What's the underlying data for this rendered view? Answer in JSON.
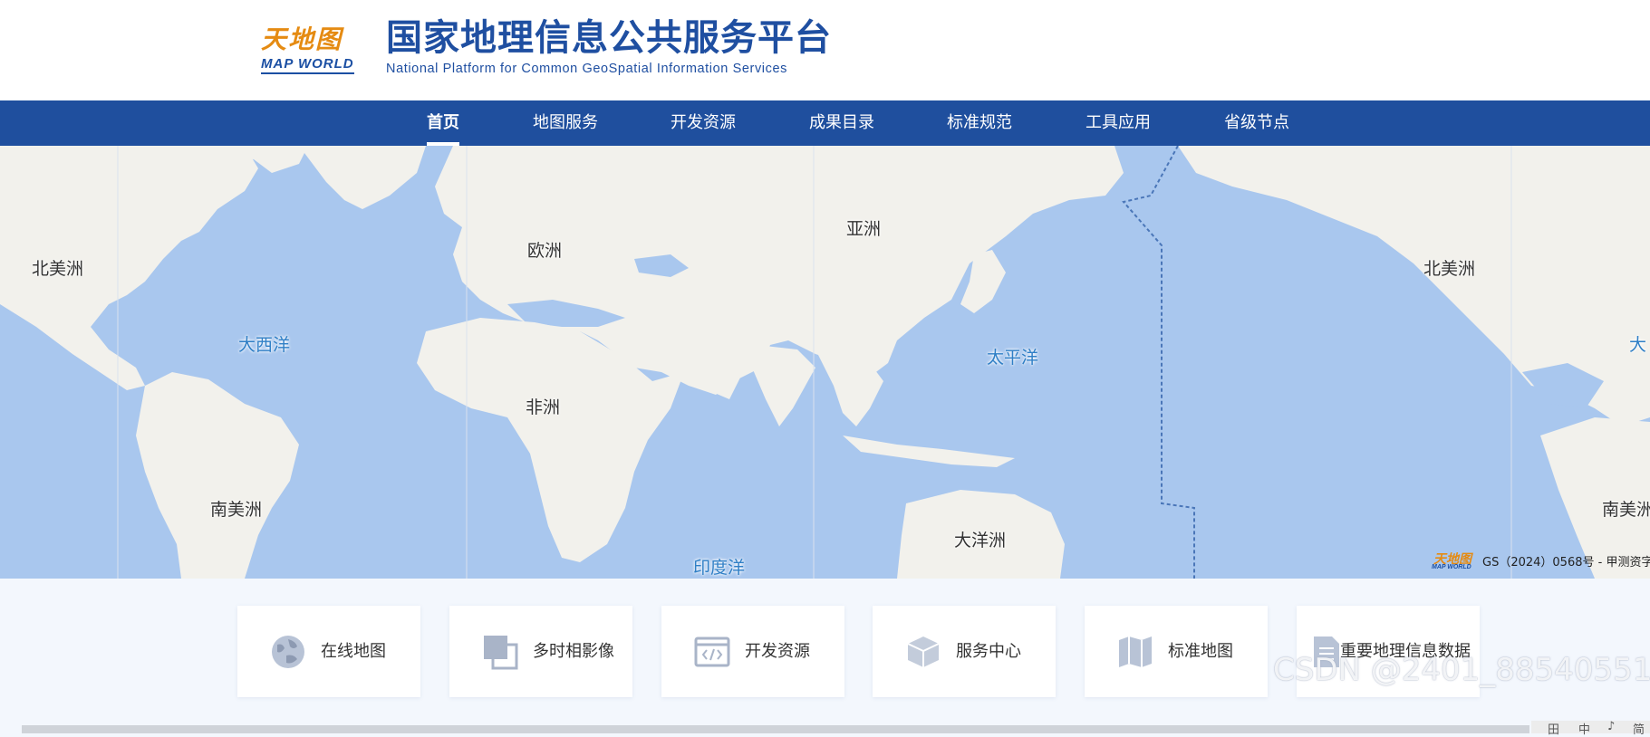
{
  "header": {
    "logo_cn": "天地图",
    "logo_en": "MAP WORLD",
    "title_cn": "国家地理信息公共服务平台",
    "title_en": "National Platform for Common GeoSpatial Information Services"
  },
  "nav": {
    "items": [
      {
        "label": "首页",
        "active": true
      },
      {
        "label": "地图服务"
      },
      {
        "label": "开发资源"
      },
      {
        "label": "成果目录"
      },
      {
        "label": "标准规范"
      },
      {
        "label": "工具应用"
      },
      {
        "label": "省级节点"
      }
    ]
  },
  "map": {
    "continents": {
      "north_america_left": "北美洲",
      "europe": "欧洲",
      "asia": "亚洲",
      "north_america_right": "北美洲",
      "africa": "非洲",
      "south_america_left": "南美洲",
      "oceania": "大洋洲",
      "south_america_right": "南美洲"
    },
    "oceans": {
      "atlantic": "大西洋",
      "pacific": "太平洋",
      "indian": "印度洋",
      "atlantic_right_partial": "大"
    },
    "attribution": {
      "logo_cn": "天地图",
      "logo_en": "MAP WORLD",
      "text": "GS（2024）0568号 - 甲测资字"
    },
    "colors": {
      "ocean": "#a9c7ee",
      "land": "#f2f1ec"
    }
  },
  "cards": [
    {
      "label": "在线地图",
      "icon": "globe-icon"
    },
    {
      "label": "多时相影像",
      "icon": "layers-icon"
    },
    {
      "label": "开发资源",
      "icon": "code-window-icon"
    },
    {
      "label": "服务中心",
      "icon": "cube-icon"
    },
    {
      "label": "标准地图",
      "icon": "folded-map-icon"
    },
    {
      "label": "重要地理信息数据",
      "icon": "document-icon"
    }
  ],
  "watermark": "CSDN @2401_88540551",
  "bottom_tools": [
    "田",
    "中",
    "♪",
    "简"
  ],
  "colors": {
    "brand_blue": "#1f4f9e",
    "logo_orange": "#e58b12",
    "icon_gray": "#a9b4c8"
  }
}
